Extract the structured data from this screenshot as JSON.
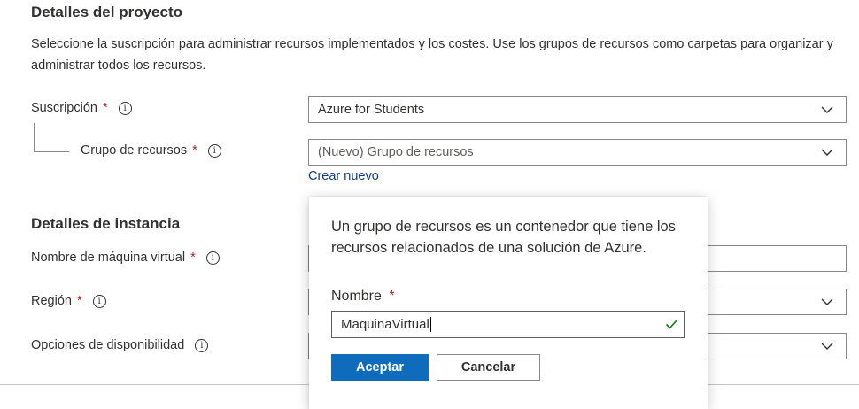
{
  "project": {
    "title": "Detalles del proyecto",
    "description": "Seleccione la suscripción para administrar recursos implementados y los costes. Use los grupos de recursos como carpetas para organizar y administrar todos los recursos.",
    "subscription": {
      "label": "Suscripción",
      "required": "*",
      "value": "Azure for Students"
    },
    "resource_group": {
      "label": "Grupo de recursos",
      "required": "*",
      "value": "(Nuevo) Grupo de recursos",
      "create_link": "Crear nuevo"
    }
  },
  "instance": {
    "title": "Detalles de instancia",
    "vm_name": {
      "label": "Nombre de máquina virtual",
      "required": "*"
    },
    "region": {
      "label": "Región",
      "required": "*"
    },
    "availability": {
      "label": "Opciones de disponibilidad"
    }
  },
  "popup": {
    "text": "Un grupo de recursos es un contenedor que tiene los recursos relacionados de una solución de Azure.",
    "name_label": "Nombre",
    "required": "*",
    "name_value": "MaquinaVirtual",
    "accept": "Aceptar",
    "cancel": "Cancelar"
  },
  "icons": {
    "info": "info-icon",
    "chevron": "chevron-down-icon",
    "check": "checkmark-icon"
  },
  "colors": {
    "accent": "#0f6cbd",
    "required": "#a4262c",
    "success": "#107c10",
    "link": "#0f3a8a"
  }
}
